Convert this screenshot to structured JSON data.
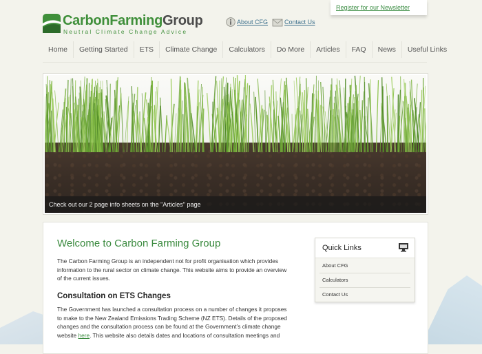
{
  "header": {
    "newsletter_link": "Register for our Newsletter",
    "logo_main_green": "CarbonFarming",
    "logo_main_gray": "Group",
    "logo_tagline": "Neutral Climate Change Advice",
    "about_link": "About CFG",
    "contact_link": "Contact Us"
  },
  "nav": {
    "items": [
      "Home",
      "Getting Started",
      "ETS",
      "Climate Change",
      "Calculators",
      "Do More",
      "Articles",
      "FAQ",
      "News",
      "Useful Links"
    ]
  },
  "hero": {
    "caption": "Check out our 2 page info sheets on the \"Articles\" page"
  },
  "main": {
    "title": "Welcome to Carbon Farming Group",
    "intro_line1": "The Carbon Farming Group is an independent not for profit organisation which provides",
    "intro_line2": "information to the rural sector on climate change. This website aims to provide an overview",
    "intro_line3": "of the current issues.",
    "ets_heading": "Consultation on ETS Changes",
    "ets_line1": "The Government has launched a consultation process on a number of changes it proposes",
    "ets_line2": "to make to the New Zealand Emissions Trading Scheme (NZ ETS). Details of the proposed",
    "ets_line3": "changes and the consultation process can be found at the Government’s climate change",
    "ets_line4_pre": "website",
    "ets_line4_link": "here",
    "ets_line4_post": ". This website also details dates and locations of consultation meetings and"
  },
  "quick_links": {
    "title": "Quick Links",
    "items": [
      "About CFG",
      "Calculators",
      "Contact Us"
    ]
  },
  "colors": {
    "brand_green": "#3f8f3a",
    "link_blue": "#3b6f8c",
    "background": "#f3f3ec"
  }
}
